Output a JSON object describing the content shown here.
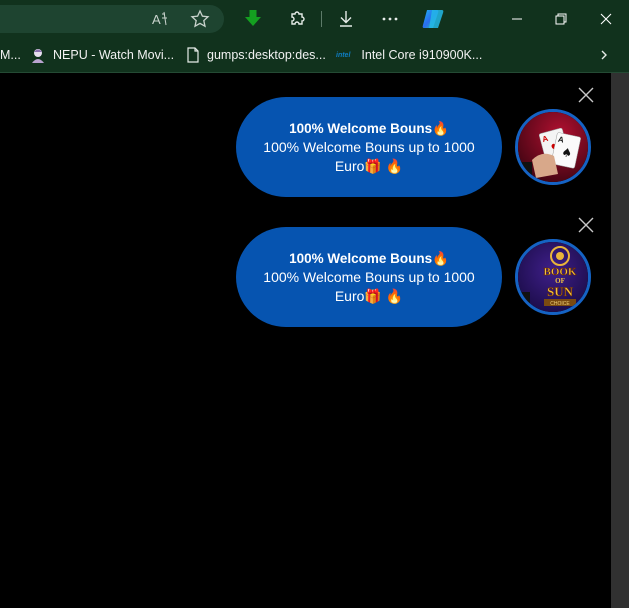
{
  "toolbar": {
    "icons": [
      "read-aloud-icon",
      "favorite-star-icon",
      "download-arrow-icon",
      "extensions-icon",
      "downloads-icon",
      "more-icon",
      "copilot-icon"
    ]
  },
  "bookmarks": {
    "items": [
      {
        "label": "M..."
      },
      {
        "label": "NEPU - Watch Movi..."
      },
      {
        "label": "gumps:desktop:des..."
      },
      {
        "label": "Intel Core i910900K..."
      }
    ],
    "intel_logo_text": "intel"
  },
  "notifications": [
    {
      "title": "100% Welcome Bouns🔥",
      "body": "100% Welcome Bouns up to 1000 Euro🎁 🔥",
      "avatar": "casino-cards-avatar"
    },
    {
      "title": "100% Welcome Bouns🔥",
      "body": "100% Welcome Bouns up to 1000 Euro🎁 🔥",
      "avatar": "book-of-sun-avatar",
      "avatar_text": {
        "line1": "BOOK",
        "line2": "OF",
        "line3": "SUN",
        "line4": "CHOICE"
      }
    }
  ],
  "colors": {
    "chrome_bg": "#11321d",
    "bubble_bg": "#0654b0",
    "avatar_border": "#1563c4",
    "page_bg": "#000000"
  }
}
